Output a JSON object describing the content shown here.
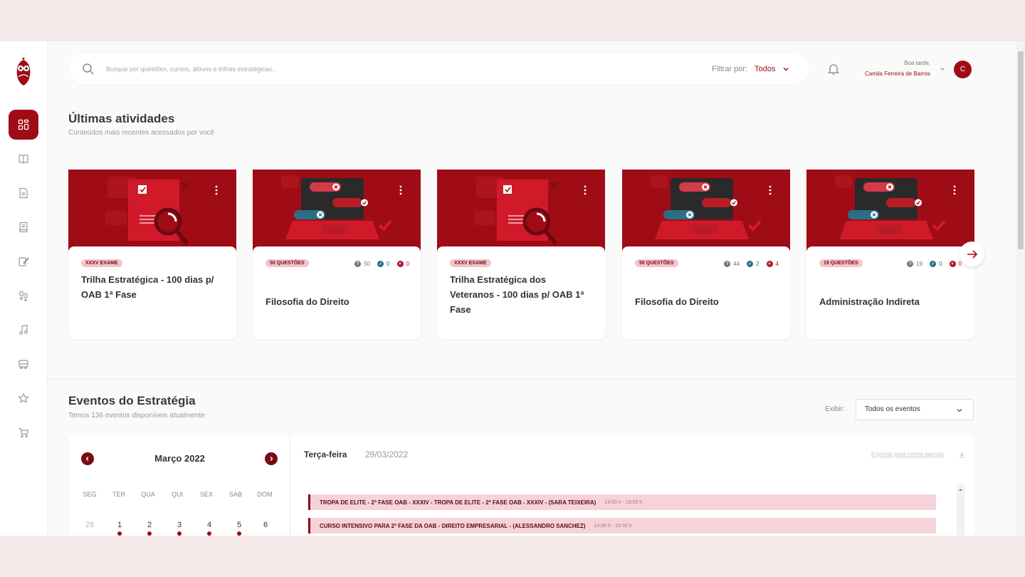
{
  "search": {
    "placeholder": "Busque por questões, cursos, álbuns e trilhas estratégicas...",
    "filter_label": "Filtrar por:",
    "filter_value": "Todos"
  },
  "user": {
    "greeting": "Boa tarde,",
    "name": "Camila Ferreira de Barros",
    "initial": "C"
  },
  "sidebar": {
    "items": [
      {
        "icon": "dashboard-icon",
        "active": true
      },
      {
        "icon": "book-open-icon",
        "active": false
      },
      {
        "icon": "document-icon",
        "active": false
      },
      {
        "icon": "notebook-icon",
        "active": false
      },
      {
        "icon": "edit-note-icon",
        "active": false
      },
      {
        "icon": "footsteps-icon",
        "active": false
      },
      {
        "icon": "music-icon",
        "active": false
      },
      {
        "icon": "bus-icon",
        "active": false
      },
      {
        "icon": "star-icon",
        "active": false
      },
      {
        "icon": "cart-icon",
        "active": false
      }
    ]
  },
  "activities": {
    "title": "Últimas atividades",
    "subtitle": "Conteúdos mais recentes acessados por você",
    "cards": [
      {
        "type": "trail",
        "badge": "XXXV EXAME",
        "title": "Trilha Estratégica - 100 dias p/ OAB 1ª Fase"
      },
      {
        "type": "questions",
        "badge": "50 QUESTÕES",
        "title": "Filosofia do Direito",
        "answered": "50",
        "correct": "0",
        "wrong": "0"
      },
      {
        "type": "trail",
        "badge": "XXXV EXAME",
        "title": "Trilha Estratégica dos Veteranos - 100 dias p/ OAB 1ª Fase"
      },
      {
        "type": "questions",
        "badge": "50 QUESTÕES",
        "title": "Filosofia do Direito",
        "answered": "44",
        "correct": "2",
        "wrong": "4"
      },
      {
        "type": "questions",
        "badge": "19 QUESTÕES",
        "title": "Administração Indireta",
        "answered": "19",
        "correct": "0",
        "wrong": "0"
      }
    ]
  },
  "events": {
    "title": "Eventos do Estratégia",
    "subtitle": "Temos 136 eventos disponíveis atualmente",
    "exibir_label": "Exibir:",
    "exibir_value": "Todos os eventos",
    "calendar": {
      "month": "Março 2022",
      "weekdays": [
        "SEG",
        "TER",
        "QUA",
        "QUI",
        "SEX",
        "SAB",
        "DOM"
      ],
      "days": [
        "28",
        "1",
        "2",
        "3",
        "4",
        "5",
        "6"
      ]
    },
    "selected_day": "Terça-feira",
    "selected_date": "29/03/2022",
    "export_label": "Exportar para minha agenda",
    "items": [
      {
        "name": "TROPA DE ELITE - 2ª FASE OAB - XXXIV - TROPA DE ELITE - 2ª FASE OAB - XXXIV - (SARA TEIXEIRA)",
        "time": "14:00 h - 18:00 h"
      },
      {
        "name": "CURSO INTENSIVO PARA 2ª FASE DA OAB - DIREITO EMPRESARIAL - (ALESSANDRO SANCHEZ)",
        "time": "14:00 h - 19:30 h"
      }
    ]
  },
  "colors": {
    "brand": "#a00c16",
    "brand_dark": "#7a0a12",
    "badge_bg": "#f3c4cb",
    "event_bg": "#f6d3da",
    "correct": "#2a6f86",
    "wrong": "#b0132a",
    "answered": "#777777"
  }
}
